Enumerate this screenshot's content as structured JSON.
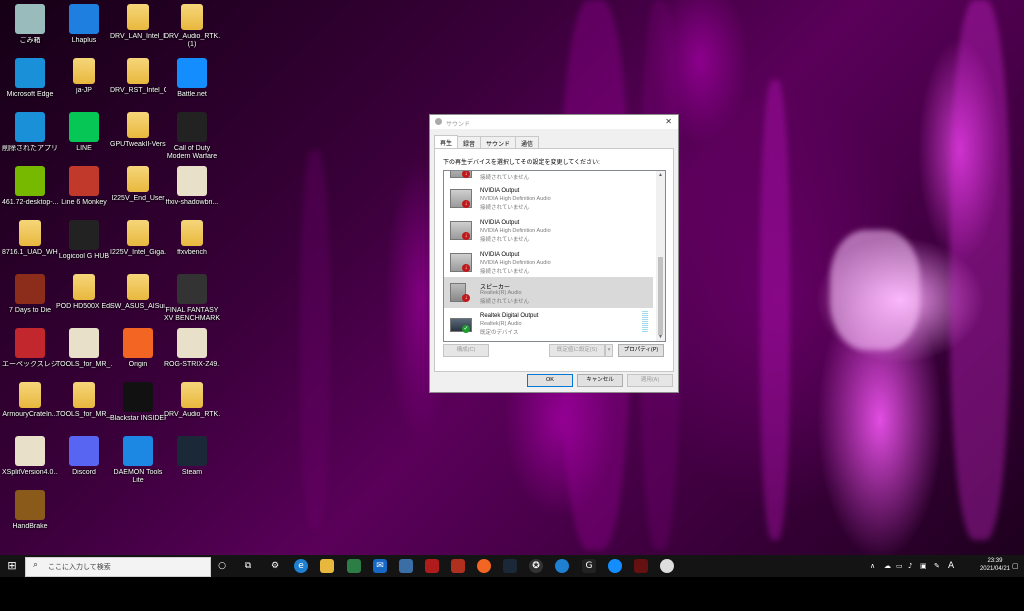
{
  "desktop": {
    "icons": [
      {
        "label": "ごみ箱",
        "icon": "recycle-bin-icon"
      },
      {
        "label": "Lhaplus",
        "icon": "lhaplus-icon"
      },
      {
        "label": "DRV_LAN_Intel_I...",
        "icon": "folder-icon"
      },
      {
        "label": "DRV_Audio_RTK...",
        "label2": "(1)",
        "icon": "folder-icon"
      },
      {
        "label": "Microsoft Edge",
        "icon": "edge-icon"
      },
      {
        "label": "ja-JP",
        "icon": "folder-icon"
      },
      {
        "label": "DRV_RST_Intel_C...",
        "icon": "folder-icon"
      },
      {
        "label": "Battle.net",
        "icon": "battlenet-icon"
      },
      {
        "label": "削除されたアプリ",
        "icon": "edge-icon"
      },
      {
        "label": "LINE",
        "icon": "line-icon"
      },
      {
        "label": "GPUTweakII-Vers...",
        "icon": "folder-icon"
      },
      {
        "label": "Call of Duty",
        "label2": "Modern Warfare",
        "icon": "cod-icon"
      },
      {
        "label": "461.72-desktop-...",
        "icon": "nvidia-icon"
      },
      {
        "label": "Line 6 Monkey",
        "icon": "line6-icon"
      },
      {
        "label": "I225V_End_User",
        "icon": "folder-icon"
      },
      {
        "label": "ffxiv-shadowbri...",
        "icon": "file-icon"
      },
      {
        "label": "8716.1_UAD_WH...",
        "icon": "folder-icon"
      },
      {
        "label": "Logicool G HUB",
        "icon": "ghub-icon"
      },
      {
        "label": "I225V_Intel_Giga...",
        "icon": "folder-icon"
      },
      {
        "label": "ffxvbench",
        "icon": "folder-icon"
      },
      {
        "label": "7 Days to Die",
        "icon": "game-icon"
      },
      {
        "label": "POD HD500X Edit",
        "icon": "folder-icon"
      },
      {
        "label": "SW_ASUS_AISui...",
        "icon": "folder-icon"
      },
      {
        "label": "FINAL FANTASY",
        "label2": "XV BENCHMARK",
        "icon": "ffxv-icon"
      },
      {
        "label": "エーペックスレジェンズ",
        "icon": "apex-icon"
      },
      {
        "label": "TOOLS_for_MR_...",
        "icon": "file-icon"
      },
      {
        "label": "Origin",
        "icon": "origin-icon"
      },
      {
        "label": "ROG-STRIX-Z49...",
        "icon": "file-icon"
      },
      {
        "label": "ArmouryCrateIn...",
        "icon": "folder-icon"
      },
      {
        "label": "TOOLS_for_MR_...",
        "icon": "folder-icon"
      },
      {
        "label": "Blackstar INSIDER",
        "icon": "blackstar-icon"
      },
      {
        "label": "DRV_Audio_RTK...",
        "icon": "folder-icon"
      },
      {
        "label": "XSplitVersion4.0...",
        "icon": "file-icon"
      },
      {
        "label": "Discord",
        "icon": "discord-icon"
      },
      {
        "label": "DAEMON Tools",
        "label2": "Lite",
        "icon": "daemon-icon"
      },
      {
        "label": "Steam",
        "icon": "steam-icon"
      },
      {
        "label": "HandBrake",
        "icon": "handbrake-icon"
      }
    ]
  },
  "dialog": {
    "title": "サウンド",
    "close": "✕",
    "tabs": [
      "再生",
      "録音",
      "サウンド",
      "通信"
    ],
    "instruction": "下の再生デバイスを選択してその設定を変更してください:",
    "devices": [
      {
        "name": "",
        "sub1": "",
        "sub2": "接続されていません",
        "type": "monitor",
        "status": "down"
      },
      {
        "name": "NVIDIA Output",
        "sub1": "NVIDIA High Definition Audio",
        "sub2": "接続されていません",
        "type": "monitor",
        "status": "down"
      },
      {
        "name": "NVIDIA Output",
        "sub1": "NVIDIA High Definition Audio",
        "sub2": "接続されていません",
        "type": "monitor",
        "status": "down"
      },
      {
        "name": "NVIDIA Output",
        "sub1": "NVIDIA High Definition Audio",
        "sub2": "接続されていません",
        "type": "monitor",
        "status": "down"
      },
      {
        "name": "スピーカー",
        "sub1": "Realtek(R) Audio",
        "sub2": "接続されていません",
        "type": "speaker",
        "status": "down"
      },
      {
        "name": "Realtek Digital Output",
        "sub1": "Realtek(R) Audio",
        "sub2": "既定のデバイス",
        "type": "digital",
        "status": "ok"
      }
    ],
    "buttons": {
      "configure": "構成(C)",
      "set_default": "既定値に設定(S)",
      "properties": "プロパティ(P)",
      "ok": "OK",
      "cancel": "キャンセル",
      "apply": "適用(A)"
    }
  },
  "taskbar": {
    "search_placeholder": "ここに入力して検索",
    "clock_time": "23:39",
    "clock_date": "2021/04/21",
    "ime": "A"
  }
}
